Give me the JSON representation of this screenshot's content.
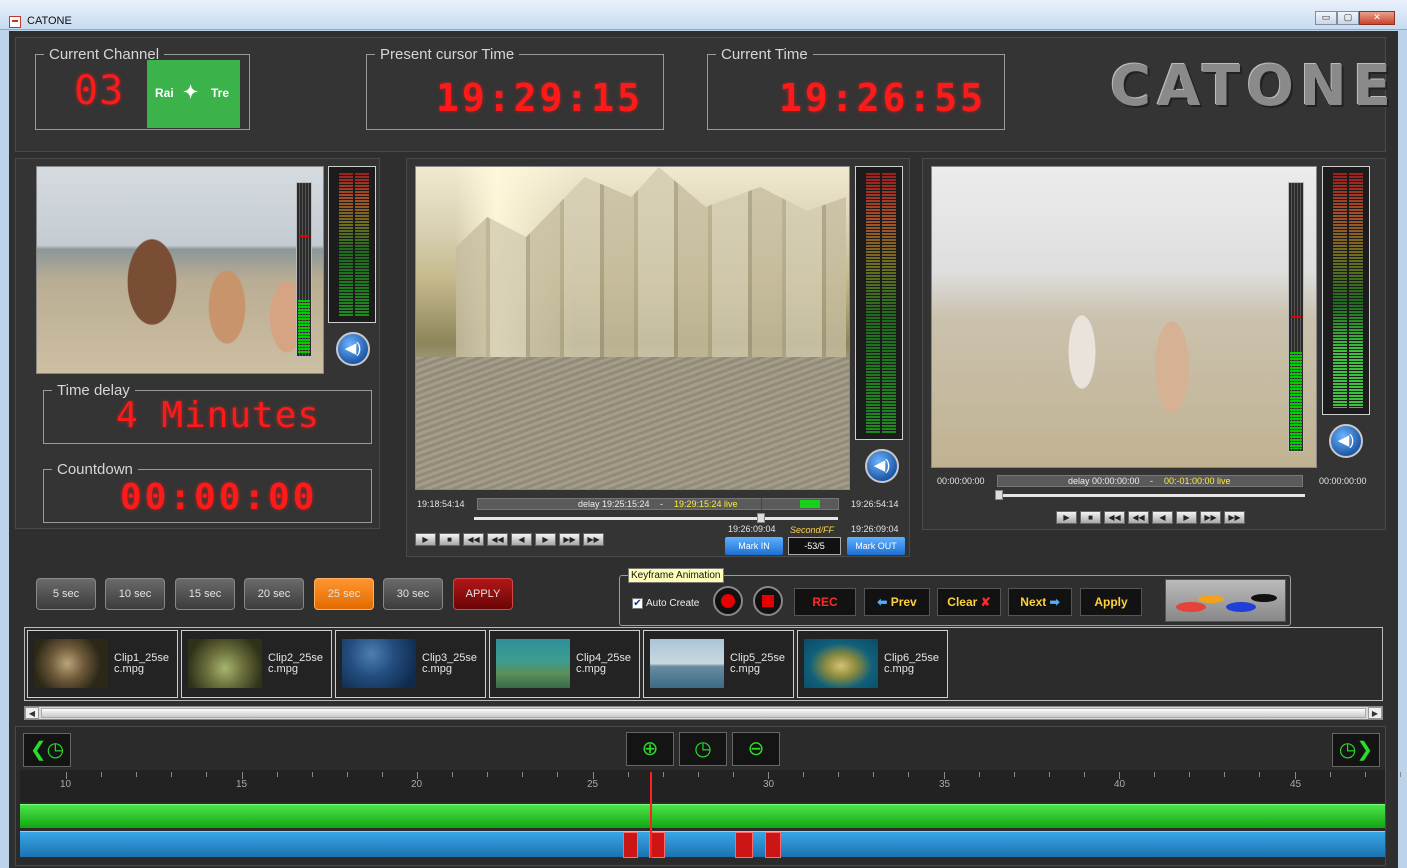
{
  "window": {
    "title": "CATONE",
    "buttons": [
      "▭",
      "▢",
      "✕"
    ]
  },
  "header": {
    "channel_legend": "Current Channel",
    "channel_number": "03",
    "channel_logo": {
      "left": "Rai",
      "right": "Tre"
    },
    "cursor_legend": "Present cursor Time",
    "cursor_time": "19:29:15",
    "current_legend": "Current Time",
    "current_time": "19:26:55",
    "brand": "CATONE"
  },
  "left_panel": {
    "delay_legend": "Time delay",
    "delay_value": "4 Minutes",
    "countdown_legend": "Countdown",
    "countdown_value": "00:00:00"
  },
  "center_panel": {
    "start_time": "19:18:54:14",
    "scrub_label": "delay 19:25:15:24",
    "scrub_live": "19:29:15:24 live",
    "end_time": "19:26:54:14",
    "cursor_time": "19:26:09:04",
    "speed_label": "Second/FF",
    "speed_value": "-53/5",
    "mark_time": "19:26:09:04",
    "mark_in": "Mark IN",
    "mark_out": "Mark OUT"
  },
  "right_panel": {
    "start_time": "00:00:00:00",
    "scrub_label": "delay 00:00:00:00",
    "scrub_live": "00:-01:00:00 live",
    "end_time": "00:00:00:00"
  },
  "sec_buttons": [
    "5 sec",
    "10 sec",
    "15 sec",
    "20 sec",
    "25 sec",
    "30 sec",
    "APPLY"
  ],
  "active_sec": "25 sec",
  "keyframe": {
    "legend": "Keyframe Animation",
    "auto_create": "Auto Create",
    "auto_create_checked": true,
    "rec": "REC",
    "prev": "Prev",
    "clear": "Clear",
    "next": "Next",
    "apply": "Apply"
  },
  "clips": [
    {
      "name": "Clip1_25sec.mpg"
    },
    {
      "name": "Clip2_25sec.mpg"
    },
    {
      "name": "Clip3_25sec.mpg"
    },
    {
      "name": "Clip4_25sec.mpg"
    },
    {
      "name": "Clip5_25sec.mpg"
    },
    {
      "name": "Clip6_25sec.mpg"
    }
  ],
  "timeline": {
    "ticks": [
      "10",
      "15",
      "20",
      "25",
      "30",
      "35",
      "40",
      "45"
    ],
    "buttons": [
      "back-icon",
      "zoom-in-icon",
      "clock-icon",
      "zoom-out-icon",
      "forward-icon"
    ]
  },
  "colors": {
    "led_red": "#ff1a1a",
    "accent_orange": "#ff8c1a",
    "track_green": "#22c522",
    "track_blue": "#2a8fd2"
  }
}
